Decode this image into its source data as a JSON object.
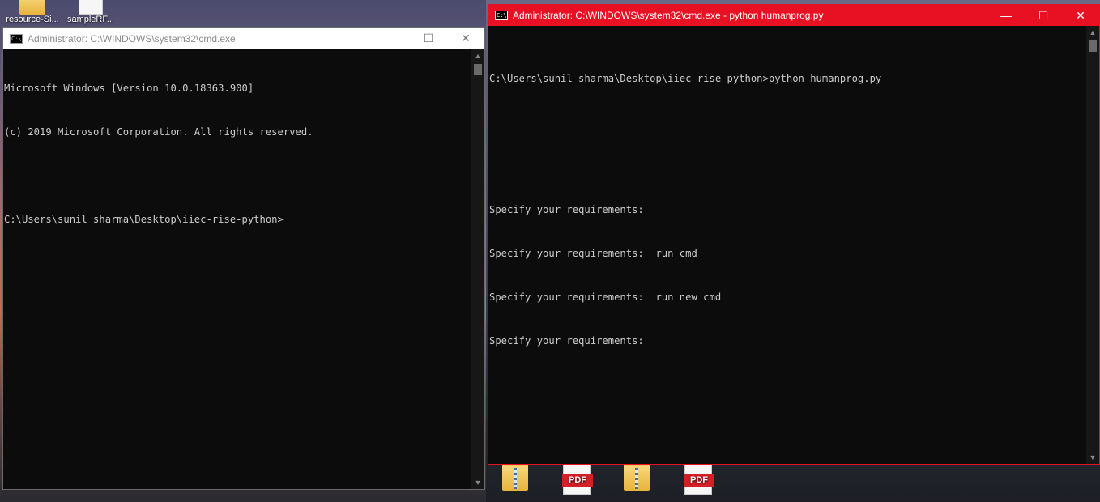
{
  "desktop": {
    "icons_top": [
      {
        "label": "resource-Si...",
        "type": "folder"
      },
      {
        "label": "sampleRF...",
        "type": "file"
      }
    ],
    "icons_bottom": [
      {
        "label": "",
        "type": "folder"
      },
      {
        "label": "PDF",
        "type": "pdf"
      },
      {
        "label": "",
        "type": "zip-folder"
      },
      {
        "label": "PDF",
        "type": "pdf"
      }
    ]
  },
  "window_left": {
    "title": "Administrator: C:\\WINDOWS\\system32\\cmd.exe",
    "icon": "cmd-icon",
    "controls": {
      "minimize": "—",
      "maximize": "☐",
      "close": "✕"
    },
    "lines": [
      "Microsoft Windows [Version 10.0.18363.900]",
      "(c) 2019 Microsoft Corporation. All rights reserved.",
      "",
      "C:\\Users\\sunil sharma\\Desktop\\iiec-rise-python>"
    ]
  },
  "window_right": {
    "title": "Administrator: C:\\WINDOWS\\system32\\cmd.exe - python  humanprog.py",
    "icon": "cmd-icon",
    "title_bar_color": "#e81123",
    "controls": {
      "minimize": "—",
      "maximize": "☐",
      "close": "✕"
    },
    "lines": [
      "C:\\Users\\sunil sharma\\Desktop\\iiec-rise-python>python humanprog.py",
      "",
      "",
      "Specify your requirements:",
      "Specify your requirements:  run cmd",
      "Specify your requirements:  run new cmd",
      "Specify your requirements:"
    ]
  },
  "scrollbar": {
    "up": "▲",
    "down": "▼"
  }
}
